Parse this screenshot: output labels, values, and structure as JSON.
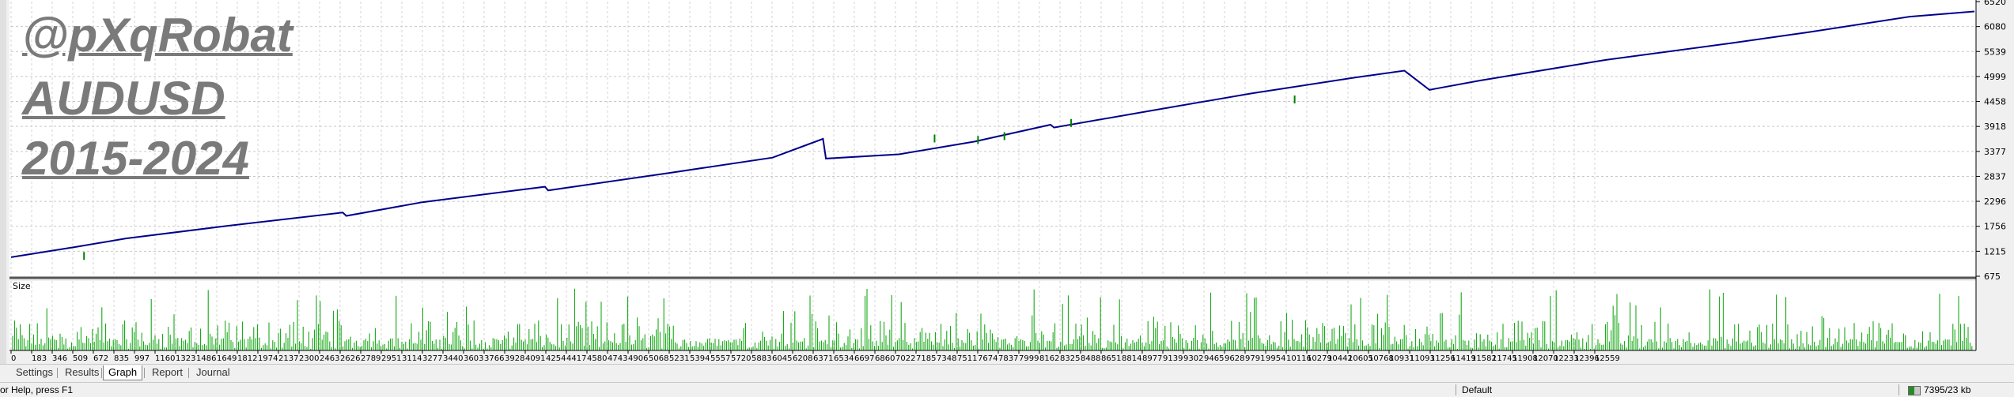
{
  "watermark": {
    "line1": "@pXqRobat",
    "line2": "AUDUSD",
    "line3": "2015-2024"
  },
  "chart_data": [
    {
      "type": "line",
      "title": "",
      "series": [
        {
          "name": "",
          "color": "#00008b",
          "x": [
            0,
            420,
            740,
            1400,
            2137,
            2160,
            2650,
            3440,
            3460,
            4254,
            4906,
            5231,
            5250,
            5720,
            6208,
            6697,
            6720,
            7348,
            7999,
            8650,
            8977,
            9139,
            9170,
            9465,
            10279,
            11093,
            11582,
            12233,
            12650
          ],
          "values": [
            1080,
            1300,
            1480,
            1750,
            2030,
            1960,
            2250,
            2580,
            2500,
            2880,
            3200,
            3600,
            3180,
            3270,
            3540,
            3900,
            3840,
            4200,
            4570,
            4900,
            5050,
            4640,
            4660,
            4840,
            5280,
            5640,
            5870,
            6200,
            6310
          ]
        },
        {
          "name": "",
          "color": "#008000",
          "x": [
            470,
            5950,
            6230,
            6400,
            6830,
            8270
          ],
          "values": [
            1090,
            3590,
            3560,
            3640,
            3920,
            4420
          ]
        }
      ],
      "ylim": [
        675,
        6520
      ],
      "yticks": [
        "6520",
        "6080",
        "5539",
        "4999",
        "4458",
        "3918",
        "3377",
        "2837",
        "2296",
        "1756",
        "1215",
        "675"
      ],
      "grid": true
    },
    {
      "type": "bar",
      "title": "Size",
      "bar_color": "#00a000",
      "xticks": [
        "0",
        "183",
        "346",
        "509",
        "672",
        "835",
        "997",
        "1160",
        "1323",
        "1486",
        "1649",
        "1812",
        "1974",
        "2137",
        "2300",
        "2463",
        "2626",
        "2789",
        "2951",
        "3114",
        "3277",
        "3440",
        "3603",
        "3766",
        "3928",
        "4091",
        "4254",
        "4417",
        "4580",
        "4743",
        "4906",
        "5068",
        "5231",
        "5394",
        "5557",
        "5720",
        "5883",
        "6045",
        "6208",
        "6371",
        "6534",
        "6697",
        "6860",
        "7022",
        "7185",
        "7348",
        "7511",
        "7674",
        "7837",
        "7999",
        "8162",
        "8325",
        "8488",
        "8651",
        "8814",
        "8977",
        "9139",
        "9302",
        "9465",
        "9628",
        "9791",
        "9954",
        "10116",
        "10279",
        "10442",
        "10605",
        "10768",
        "10931",
        "11093",
        "11256",
        "11419",
        "11582",
        "11745",
        "11908",
        "12070",
        "12233",
        "12396",
        "12559"
      ]
    }
  ],
  "tabs": [
    {
      "label": "Settings"
    },
    {
      "label": "Results"
    },
    {
      "label": "Graph"
    },
    {
      "label": "Report"
    },
    {
      "label": "Journal"
    }
  ],
  "status": {
    "help": "or Help, press F1",
    "profile": "Default",
    "traffic": "7395/23 kb"
  }
}
